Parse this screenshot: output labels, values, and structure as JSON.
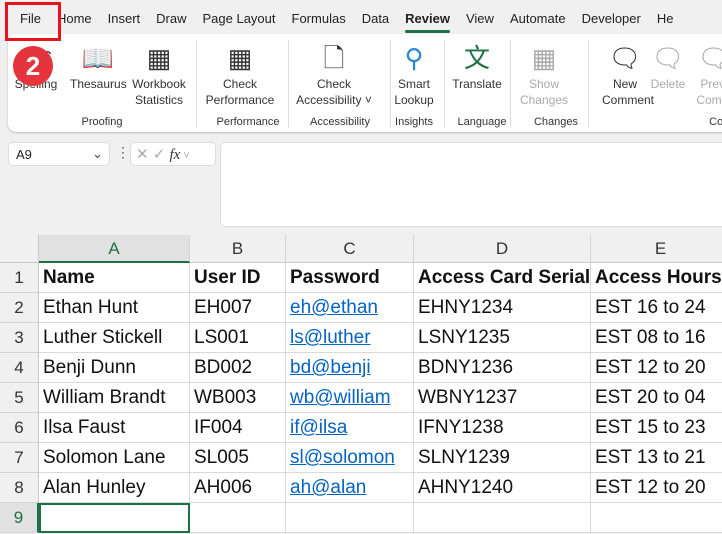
{
  "tabs": [
    "File",
    "Home",
    "Insert",
    "Draw",
    "Page Layout",
    "Formulas",
    "Data",
    "Review",
    "View",
    "Automate",
    "Developer",
    "He"
  ],
  "active_tab": "Review",
  "step_badge": "2",
  "ribbon": {
    "buttons": [
      {
        "label": "Spelling",
        "icon": "spelling-icon"
      },
      {
        "label": "Thesaurus",
        "icon": "book-icon"
      },
      {
        "label": "Workbook\nStatistics",
        "icon": "statistics-icon"
      },
      {
        "label": "Check\nPerformance",
        "icon": "performance-icon"
      },
      {
        "label": "Check\nAccessibility ˅",
        "icon": "accessibility-icon"
      },
      {
        "label": "Smart\nLookup",
        "icon": "search-icon"
      },
      {
        "label": "Translate",
        "icon": "translate-icon"
      },
      {
        "label": "Show\nChanges",
        "icon": "changes-icon"
      },
      {
        "label": "New\nComment",
        "icon": "new-comment-icon"
      },
      {
        "label": "Delete",
        "icon": "delete-comment-icon"
      },
      {
        "label": "Previ\nComm",
        "icon": "previous-comment-icon"
      }
    ],
    "groups": [
      "Proofing",
      "Performance",
      "Accessibility",
      "Insights",
      "Language",
      "Changes",
      "Cor"
    ]
  },
  "name_box": "A9",
  "fx": "fx",
  "columns": [
    "A",
    "B",
    "C",
    "D",
    "E"
  ],
  "rows": [
    "1",
    "2",
    "3",
    "4",
    "5",
    "6",
    "7",
    "8",
    "9"
  ],
  "table": [
    [
      "Name",
      "User ID",
      "Password",
      "Access Card Serial",
      "Access Hours"
    ],
    [
      "Ethan Hunt",
      "EH007",
      "eh@ethan",
      "EHNY1234",
      "EST 16 to 24"
    ],
    [
      "Luther Stickell",
      "LS001",
      "ls@luther",
      "LSNY1235",
      "EST 08 to 16"
    ],
    [
      "Benji Dunn",
      "BD002",
      "bd@benji",
      "BDNY1236",
      "EST 12 to 20"
    ],
    [
      "William Brandt",
      "WB003",
      "wb@william",
      "WBNY1237",
      "EST 20 to 04"
    ],
    [
      "Ilsa Faust",
      "IF004",
      "if@ilsa",
      "IFNY1238",
      "EST 15 to 23"
    ],
    [
      "Solomon Lane",
      "SL005",
      "sl@solomon",
      "SLNY1239",
      "EST 13 to 21"
    ],
    [
      "Alan Hunley",
      "AH006",
      "ah@alan",
      "AHNY1240",
      "EST 12 to 20"
    ],
    [
      "",
      "",
      "",
      "",
      ""
    ]
  ],
  "colors": {
    "accent": "#1e7145",
    "highlight": "#e8141c",
    "link": "#0563c1"
  }
}
